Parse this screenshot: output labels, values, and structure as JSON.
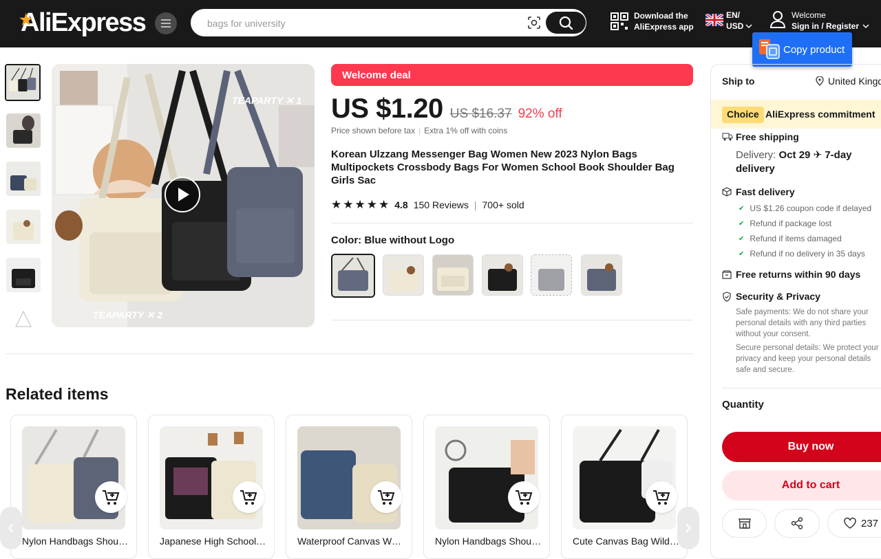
{
  "header": {
    "logo": "AliExpress",
    "search_placeholder": "bags for university",
    "app_line1": "Download the",
    "app_line2": "AliExpress app",
    "lang_line1": "EN/",
    "lang_line2": "USD",
    "account_line1": "Welcome",
    "account_line2": "Sign in / Register"
  },
  "extension": {
    "copy_label": "Copy product"
  },
  "product": {
    "welcome_deal": "Welcome deal",
    "price": "US $1.20",
    "old_price": "US $16.37",
    "discount": "92% off",
    "price_note": "Price shown before tax",
    "coins_note": "Extra 1% off with coins",
    "title": "Korean Ulzzang Messenger Bag Women New 2023 Nylon Bags Multipockets Crossbody Bags For Women School Book Shoulder Bag Girls Sac",
    "rating": "4.8",
    "reviews": "150 Reviews",
    "sold": "700+ sold",
    "color_label": "Color: Blue without Logo",
    "main_image_text_top": "TEAPARTY ✕ 1",
    "main_image_text_bottom": "TEAPARTY ✕ 2",
    "stars": 5
  },
  "related": {
    "title": "Related items",
    "items": [
      {
        "name": "Nylon Handbags Shoulder Bag"
      },
      {
        "name": "Japanese High School Bag"
      },
      {
        "name": "Waterproof Canvas Women Bag"
      },
      {
        "name": "Nylon Handbags Shoulder Bag"
      },
      {
        "name": "Cute Canvas Bag Wild Bag"
      }
    ]
  },
  "panel": {
    "ship_to_label": "Ship to",
    "ship_to_value": "United Kingdom",
    "choice_tag": "Choice",
    "commitment": "AliExpress commitment",
    "free_shipping": "Free shipping",
    "delivery_prefix": "Delivery:",
    "delivery_date": "Oct 29",
    "delivery_speed": "7-day delivery",
    "fast_delivery": "Fast delivery",
    "fast_items": [
      "US $1.26 coupon code if delayed",
      "Refund if package lost",
      "Refund if items damaged",
      "Refund if no delivery in 35 days"
    ],
    "free_returns": "Free returns within 90 days",
    "security_title": "Security & Privacy",
    "security_text1": "Safe payments: We do not share your personal details with any third parties without your consent.",
    "security_text2": "Secure personal details: We protect your privacy and keep your personal details safe and secure.",
    "quantity_label": "Quantity",
    "buy_now": "Buy now",
    "add_to_cart": "Add to cart",
    "wishlist_count": "237"
  },
  "colors": {
    "brand_red": "#fd384f",
    "buy_red": "#d3031c",
    "cart_pink": "#ffe7e9",
    "header_bg": "#191919",
    "choice_yellow": "#fddb75",
    "ext_blue": "#1e6ff6"
  }
}
